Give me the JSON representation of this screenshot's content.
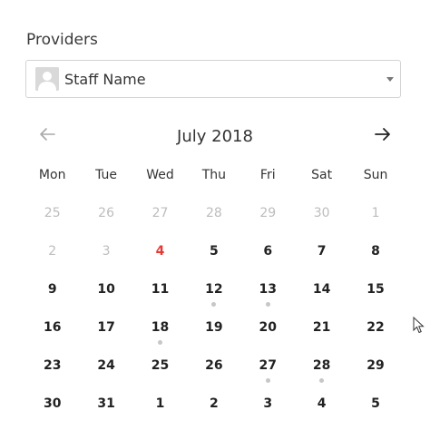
{
  "providers_label": "Providers",
  "select": {
    "value": "Staff Name",
    "avatar_icon": "user-avatar-icon",
    "caret_icon": "caret-down-icon"
  },
  "calendar": {
    "title": "July 2018",
    "prev_icon": "arrow-left-icon",
    "next_icon": "arrow-right-icon",
    "weekdays": [
      "Mon",
      "Tue",
      "Wed",
      "Thu",
      "Fri",
      "Sat",
      "Sun"
    ],
    "weeks": [
      [
        {
          "d": "25",
          "o": true
        },
        {
          "d": "26",
          "o": true
        },
        {
          "d": "27",
          "o": true
        },
        {
          "d": "28",
          "o": true
        },
        {
          "d": "29",
          "o": true
        },
        {
          "d": "30",
          "o": true
        },
        {
          "d": "1",
          "o": true
        }
      ],
      [
        {
          "d": "2",
          "o": true
        },
        {
          "d": "3",
          "o": true
        },
        {
          "d": "4",
          "today": true
        },
        {
          "d": "5"
        },
        {
          "d": "6"
        },
        {
          "d": "7"
        },
        {
          "d": "8"
        }
      ],
      [
        {
          "d": "9"
        },
        {
          "d": "10"
        },
        {
          "d": "11"
        },
        {
          "d": "12",
          "dot": true
        },
        {
          "d": "13",
          "dot": true
        },
        {
          "d": "14"
        },
        {
          "d": "15"
        }
      ],
      [
        {
          "d": "16"
        },
        {
          "d": "17"
        },
        {
          "d": "18",
          "dot": true
        },
        {
          "d": "19"
        },
        {
          "d": "20"
        },
        {
          "d": "21"
        },
        {
          "d": "22"
        }
      ],
      [
        {
          "d": "23"
        },
        {
          "d": "24"
        },
        {
          "d": "25"
        },
        {
          "d": "26"
        },
        {
          "d": "27",
          "dot": true
        },
        {
          "d": "28",
          "dot": true
        },
        {
          "d": "29"
        }
      ],
      [
        {
          "d": "30"
        },
        {
          "d": "31"
        },
        {
          "d": "1"
        },
        {
          "d": "2"
        },
        {
          "d": "3"
        },
        {
          "d": "4"
        },
        {
          "d": "5"
        }
      ]
    ]
  },
  "colors": {
    "today": "#e53935",
    "other_month": "#bdbdbd",
    "dot": "#c7c7c7"
  }
}
